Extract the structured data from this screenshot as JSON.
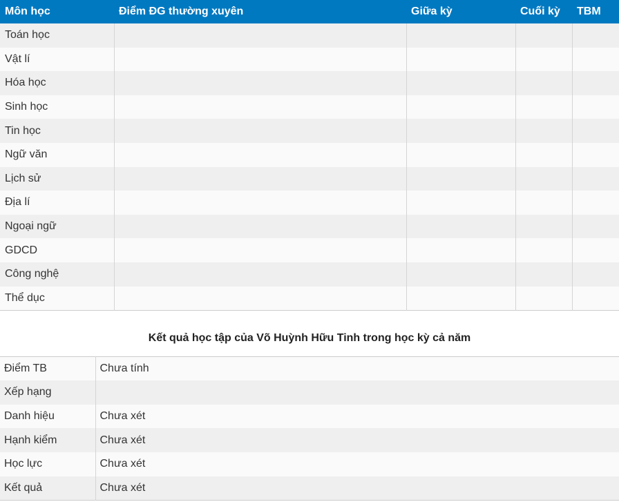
{
  "grades_table": {
    "headers": [
      "Môn học",
      "Điểm ĐG thường xuyên",
      "Giữa kỳ",
      "Cuối kỳ",
      "TBM"
    ],
    "subjects": [
      "Toán học",
      "Vật lí",
      "Hóa học",
      "Sinh học",
      "Tin học",
      "Ngữ văn",
      "Lịch sử",
      "Địa lí",
      "Ngoại ngữ",
      "GDCD",
      "Công nghệ",
      "Thể dục"
    ]
  },
  "summary": {
    "title": "Kết quả học tập của Võ Huỳnh Hữu Tinh trong học kỳ cả năm",
    "rows": [
      {
        "label": "Điểm TB",
        "value": "Chưa tính"
      },
      {
        "label": "Xếp hạng",
        "value": ""
      },
      {
        "label": "Danh hiệu",
        "value": "Chưa xét"
      },
      {
        "label": "Hạnh kiểm",
        "value": "Chưa xét"
      },
      {
        "label": "Học lực",
        "value": "Chưa xét"
      },
      {
        "label": "Kết quả",
        "value": "Chưa xét"
      }
    ]
  }
}
